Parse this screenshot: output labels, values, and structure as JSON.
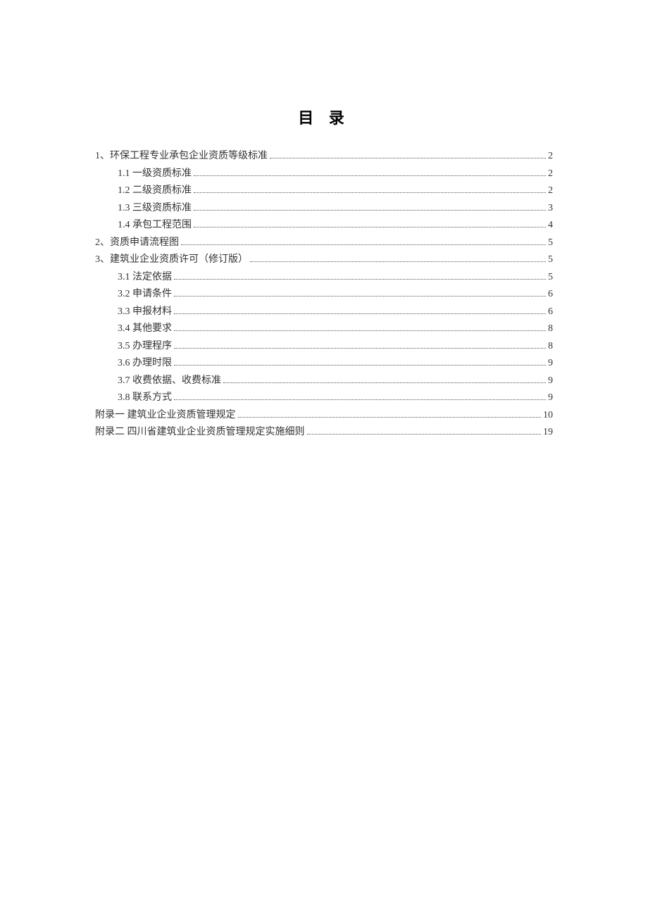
{
  "title": "目 录",
  "entries": [
    {
      "level": 0,
      "label": "1、环保工程专业承包企业资质等级标准",
      "page": "2"
    },
    {
      "level": 1,
      "label": "1.1 一级资质标准",
      "page": "2"
    },
    {
      "level": 1,
      "label": "1.2 二级资质标准",
      "page": "2"
    },
    {
      "level": 1,
      "label": "1.3 三级资质标准",
      "page": "3"
    },
    {
      "level": 1,
      "label": "1.4 承包工程范围",
      "page": "4"
    },
    {
      "level": 0,
      "label": "2、资质申请流程图",
      "page": "5"
    },
    {
      "level": 0,
      "label": "3、建筑业企业资质许可（修订版）",
      "page": "5"
    },
    {
      "level": 1,
      "label": "3.1 法定依据",
      "page": "5"
    },
    {
      "level": 1,
      "label": "3.2 申请条件",
      "page": "6"
    },
    {
      "level": 1,
      "label": "3.3 申报材料",
      "page": "6"
    },
    {
      "level": 1,
      "label": "3.4 其他要求",
      "page": "8"
    },
    {
      "level": 1,
      "label": "3.5 办理程序",
      "page": "8"
    },
    {
      "level": 1,
      "label": "3.6 办理时限",
      "page": "9"
    },
    {
      "level": 1,
      "label": "3.7 收费依据、收费标准",
      "page": "9"
    },
    {
      "level": 1,
      "label": "3.8 联系方式",
      "page": "9"
    },
    {
      "level": 0,
      "label": "附录一  建筑业企业资质管理规定",
      "page": "10"
    },
    {
      "level": 0,
      "label": "附录二  四川省建筑业企业资质管理规定实施细则",
      "page": "19"
    }
  ]
}
